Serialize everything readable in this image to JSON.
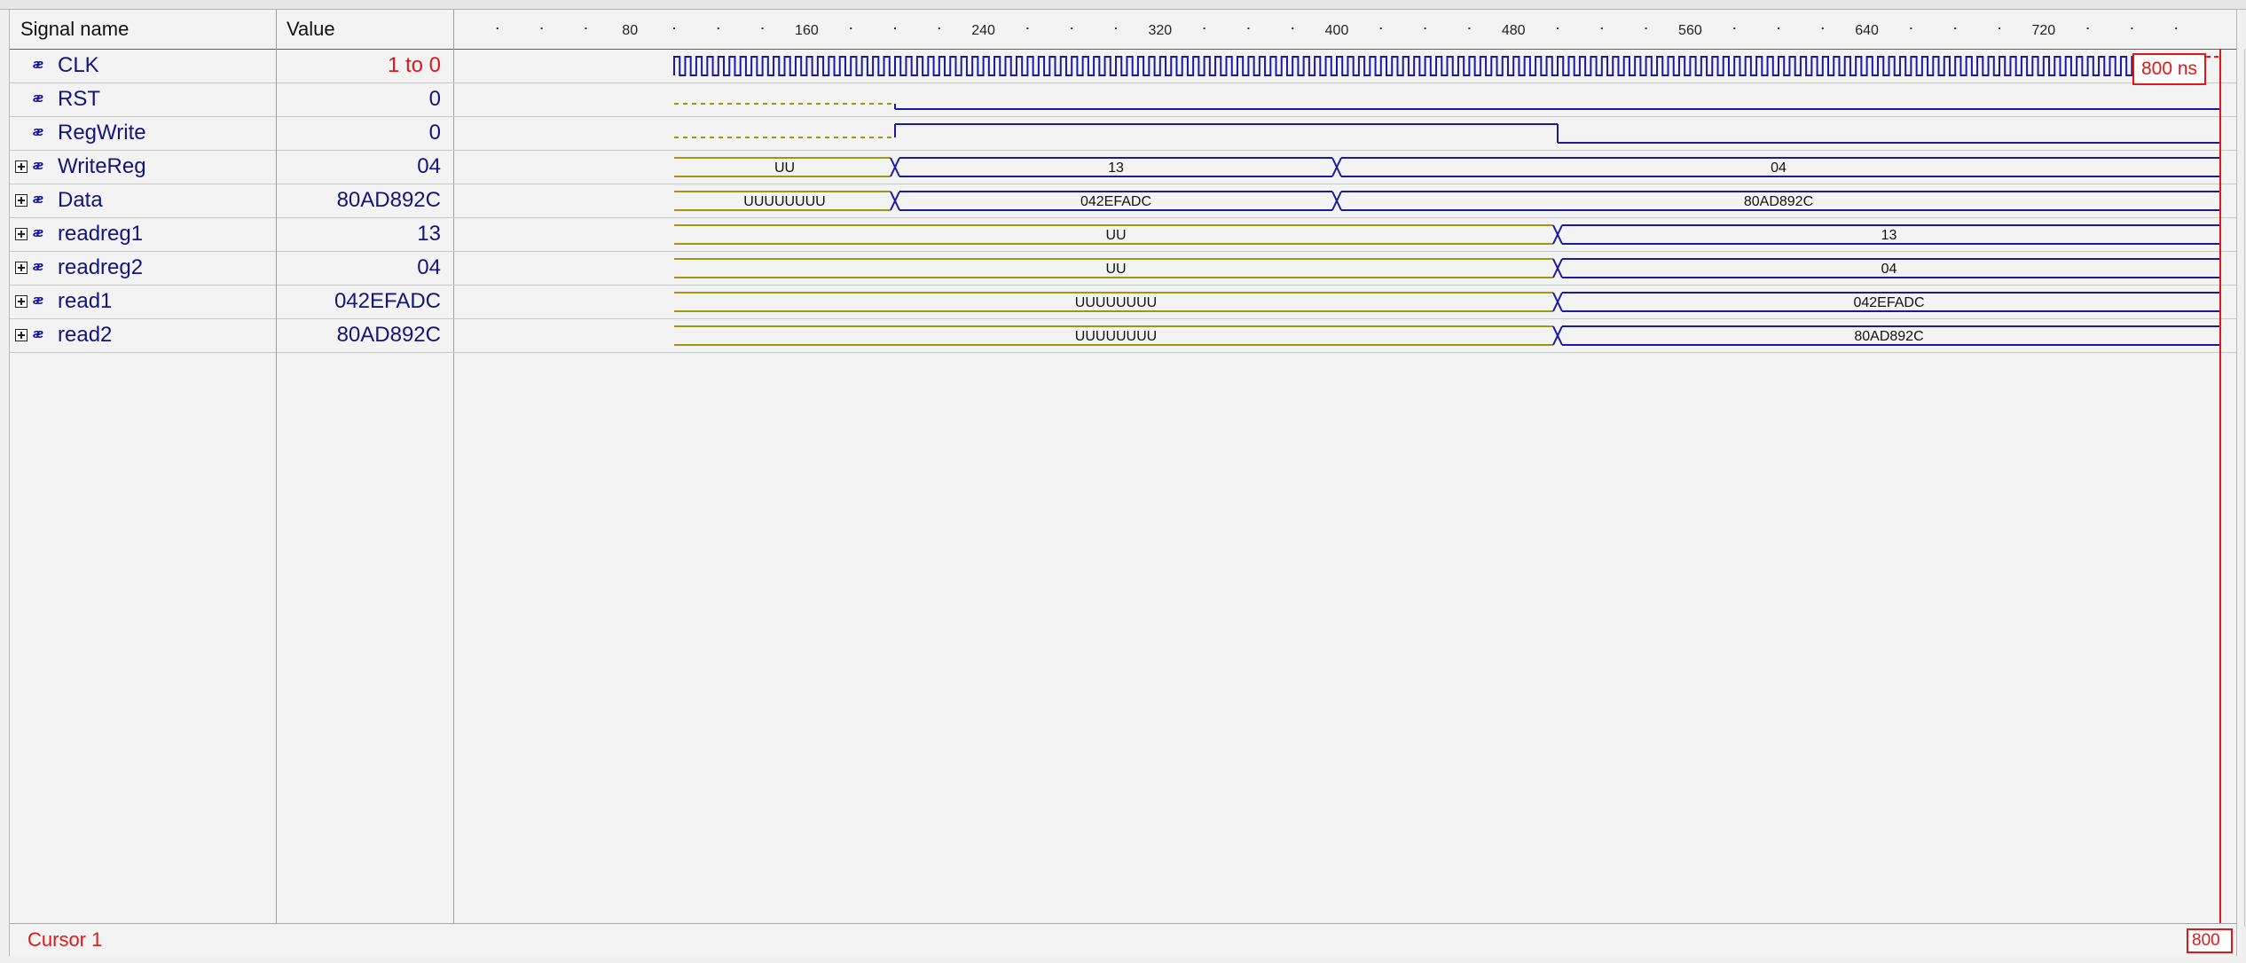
{
  "columns": {
    "signal_name": "Signal name",
    "value": "Value"
  },
  "time_ruler": {
    "labels": [
      "80",
      "160",
      "240",
      "320",
      "400",
      "480",
      "560",
      "640",
      "720"
    ],
    "label_values": [
      80,
      160,
      240,
      320,
      400,
      480,
      560,
      640,
      720
    ],
    "start": 0,
    "end": 800,
    "minor_step": 20
  },
  "signals": [
    {
      "name": "CLK",
      "value": "1 to 0",
      "expandable": false,
      "value_red": true
    },
    {
      "name": "RST",
      "value": "0",
      "expandable": false
    },
    {
      "name": "RegWrite",
      "value": "0",
      "expandable": false
    },
    {
      "name": "WriteReg",
      "value": "04",
      "expandable": true
    },
    {
      "name": "Data",
      "value": "80AD892C",
      "expandable": true
    },
    {
      "name": "readreg1",
      "value": "13",
      "expandable": true
    },
    {
      "name": "readreg2",
      "value": "04",
      "expandable": true
    },
    {
      "name": "read1",
      "value": "042EFADC",
      "expandable": true
    },
    {
      "name": "read2",
      "value": "80AD892C",
      "expandable": true
    }
  ],
  "waves": {
    "CLK": {
      "type": "clock",
      "start": 100,
      "period": 5
    },
    "RST": {
      "type": "bit",
      "segments": [
        [
          100,
          200,
          "U"
        ],
        [
          200,
          800,
          0
        ]
      ]
    },
    "RegWrite": {
      "type": "bit",
      "segments": [
        [
          100,
          200,
          "U"
        ],
        [
          200,
          500,
          1
        ],
        [
          500,
          800,
          0
        ]
      ]
    },
    "WriteReg": {
      "type": "bus",
      "segments": [
        [
          100,
          200,
          "UU"
        ],
        [
          200,
          400,
          "13"
        ],
        [
          400,
          800,
          "04"
        ]
      ]
    },
    "Data": {
      "type": "bus",
      "segments": [
        [
          100,
          200,
          "UUUUUUUU"
        ],
        [
          200,
          400,
          "042EFADC"
        ],
        [
          400,
          800,
          "80AD892C"
        ]
      ]
    },
    "readreg1": {
      "type": "bus",
      "segments": [
        [
          100,
          500,
          "UU"
        ],
        [
          500,
          800,
          "13"
        ]
      ]
    },
    "readreg2": {
      "type": "bus",
      "segments": [
        [
          100,
          500,
          "UU"
        ],
        [
          500,
          800,
          "04"
        ]
      ]
    },
    "read1": {
      "type": "bus",
      "segments": [
        [
          100,
          500,
          "UUUUUUUU"
        ],
        [
          500,
          800,
          "042EFADC"
        ]
      ]
    },
    "read2": {
      "type": "bus",
      "segments": [
        [
          100,
          500,
          "UUUUUUUU"
        ],
        [
          500,
          800,
          "80AD892C"
        ]
      ]
    }
  },
  "cursor": {
    "label": "Cursor 1",
    "time": 800,
    "time_label": "800 ns",
    "time_label_short": "800 ns"
  },
  "colors": {
    "defined": "#1a1aa0",
    "undefined": "#9a9a10",
    "cursor": "#e01818",
    "grid_line": "#c8c8c8"
  }
}
